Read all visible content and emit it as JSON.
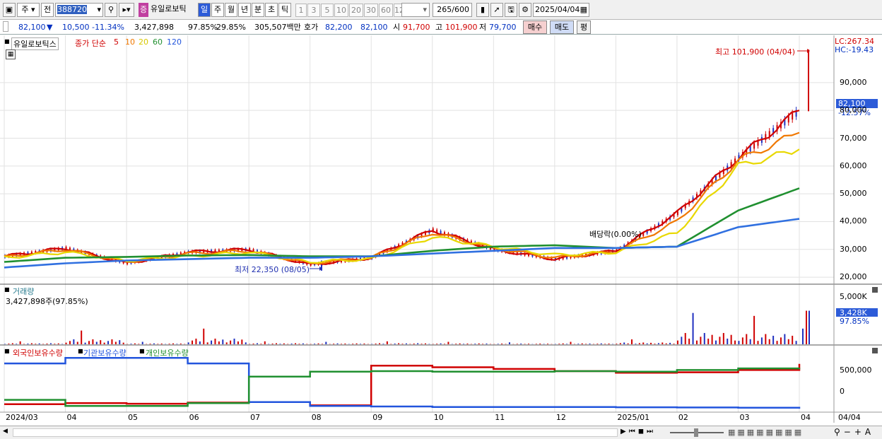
{
  "toolbar": {
    "freq_btn": "주",
    "prev_btn": "전",
    "code": "388720",
    "type_badge": "증",
    "stock_name": "유일로보틱",
    "periods": [
      "일",
      "주",
      "월",
      "년",
      "분",
      "초",
      "틱"
    ],
    "intervals": [
      "1",
      "3",
      "5",
      "10",
      "20",
      "30",
      "60",
      "120"
    ],
    "count": "265",
    "count_total": "/600",
    "date": "2025/04/04"
  },
  "quote": {
    "price": "82,100",
    "change": "10,500",
    "change_pct": "-11.34%",
    "volume": "3,427,898",
    "vol_ratio": "97.85%",
    "turnover": "29.85%",
    "amount": "305,507백만",
    "ask_label": "호가",
    "ask": "82,200",
    "bid": "82,100",
    "open_label": "시",
    "open": "91,700",
    "high_label": "고",
    "high": "101,900",
    "low_label": "저",
    "low": "79,700",
    "buy_btn": "매수",
    "sell_btn": "매도",
    "avg_btn": "평"
  },
  "colors": {
    "red": "#d00000",
    "blue": "#2255dd",
    "orange": "#f07800",
    "yellow": "#e8d800",
    "green": "#209030",
    "ma120": "#3070e0"
  },
  "price_pane": {
    "name": "유일로보틱스",
    "legend_main": "종가 단순",
    "legend_ma": [
      "5",
      "10",
      "20",
      "60",
      "120"
    ],
    "lc": "LC:267.34",
    "hc": "HC:-19.43",
    "cur_price": "82,100",
    "cur_pct": "-12.57%",
    "high_note": "최고 101,900 (04/04)",
    "low_note": "최저 22,350 (08/05)",
    "div_note": "배당락(0.00%)",
    "ticks": [
      "90,000",
      "80,000",
      "70,000",
      "60,000",
      "50,000",
      "40,000",
      "30,000",
      "20,000"
    ]
  },
  "volume_pane": {
    "title": "거래량",
    "value": "3,427,898주(97.85%)",
    "scale": "5,000K",
    "cur": "3,428K",
    "cur_pct": "97.85%"
  },
  "holdings_pane": {
    "legend": [
      "외국인보유수량",
      "기관보유수량",
      "개인보유수량"
    ],
    "ticks": [
      "500,000",
      "0"
    ]
  },
  "xaxis": [
    "2024/03",
    "04",
    "05",
    "06",
    "07",
    "08",
    "09",
    "10",
    "11",
    "12",
    "2025/01",
    "02",
    "03",
    "04"
  ],
  "xaxis_right": "04/04",
  "chart_data": {
    "type": "line",
    "title": "유일로보틱스",
    "x": [
      "2024/03",
      "2024/04",
      "2024/05",
      "2024/06",
      "2024/07",
      "2024/08",
      "2024/09",
      "2024/10",
      "2024/11",
      "2024/12",
      "2025/01",
      "2025/02",
      "2025/03",
      "2025/04"
    ],
    "series": [
      {
        "name": "5",
        "values": [
          27500,
          30500,
          25000,
          29000,
          30000,
          24500,
          27000,
          37000,
          30000,
          26500,
          29500,
          43000,
          63000,
          80000
        ]
      },
      {
        "name": "10",
        "values": [
          27200,
          30000,
          25500,
          28500,
          29500,
          25000,
          27000,
          36000,
          30500,
          27000,
          29200,
          40000,
          62000,
          72000
        ]
      },
      {
        "name": "20",
        "values": [
          27000,
          29000,
          26000,
          27500,
          29000,
          25500,
          26500,
          34500,
          31000,
          28000,
          29000,
          36000,
          60000,
          66000
        ]
      },
      {
        "name": "60",
        "values": [
          25500,
          27000,
          27300,
          27800,
          28000,
          27500,
          27500,
          29500,
          31000,
          31500,
          30500,
          31000,
          44000,
          52000
        ]
      },
      {
        "name": "120",
        "values": [
          23500,
          25000,
          26000,
          26500,
          27000,
          27000,
          27500,
          28500,
          29500,
          30500,
          30500,
          31000,
          38000,
          41000
        ]
      }
    ],
    "ylim": [
      18000,
      107000
    ],
    "high": 101900,
    "low": 22350,
    "volume_k": [
      300,
      1400,
      250,
      1600,
      300,
      250,
      300,
      250,
      200,
      250,
      500,
      3200,
      2900,
      3428
    ],
    "foreign_hold": [
      -120000,
      -100000,
      -110000,
      -90000,
      -80000,
      -140000,
      580000,
      550000,
      520000,
      480000,
      450000,
      460000,
      500000,
      610000
    ],
    "institution_hold": [
      620000,
      720000,
      720000,
      620000,
      -80000,
      -150000,
      -160000,
      -170000,
      -170000,
      -170000,
      -175000,
      -178000,
      -182000,
      -200000
    ],
    "individual_hold": [
      -40000,
      -150000,
      -150000,
      -100000,
      380000,
      470000,
      480000,
      470000,
      470000,
      480000,
      470000,
      500000,
      530000,
      540000
    ]
  }
}
